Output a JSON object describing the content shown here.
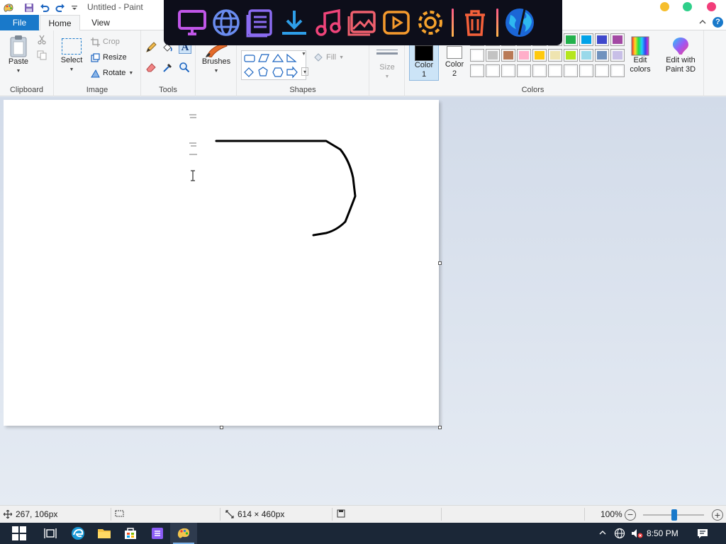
{
  "window": {
    "title": "Untitled - Paint"
  },
  "ribbon_tabs": {
    "file": "File",
    "home": "Home",
    "view": "View"
  },
  "clipboard": {
    "paste": "Paste",
    "group": "Clipboard"
  },
  "image": {
    "select": "Select",
    "crop": "Crop",
    "resize": "Resize",
    "rotate": "Rotate",
    "group": "Image"
  },
  "tools": {
    "group": "Tools",
    "brushes": "Brushes"
  },
  "shapes": {
    "fill": "Fill",
    "group": "Shapes"
  },
  "size": {
    "label": "Size"
  },
  "colors": {
    "color1": "Color",
    "color1_num": "1",
    "color2": "Color",
    "color2_num": "2",
    "edit_colors_1": "Edit",
    "edit_colors_2": "colors",
    "edit_paint3d_1": "Edit with",
    "edit_paint3d_2": "Paint 3D",
    "group": "Colors",
    "color1_value": "#000000",
    "color2_value": "#ffffff",
    "palette_row1": [
      "#000000",
      "#7f7f7f",
      "#880015",
      "#ed1c24",
      "#ff7f27",
      "#fff200",
      "#22b14c",
      "#00a2e8",
      "#3f48cc",
      "#a349a4"
    ],
    "palette_row2": [
      "#ffffff",
      "#c3c3c3",
      "#b97a57",
      "#ffaec9",
      "#ffc90e",
      "#efe4b0",
      "#b5e61d",
      "#99d9ea",
      "#7092be",
      "#c8bfe7"
    ],
    "palette_row3": [
      "#ffffff",
      "#ffffff",
      "#ffffff",
      "#ffffff",
      "#ffffff",
      "#ffffff",
      "#ffffff",
      "#ffffff",
      "#ffffff",
      "#ffffff"
    ]
  },
  "status": {
    "cursor_pos": "267, 106px",
    "canvas_size": "614 × 460px",
    "zoom": "100%"
  },
  "taskbar": {
    "clock": "8:50 PM"
  },
  "dock_icons": [
    "monitor-icon",
    "globe-icon",
    "document-icon",
    "download-icon",
    "music-icon",
    "image-icon",
    "video-icon",
    "settings-icon",
    "trash-icon",
    "world-icon"
  ]
}
